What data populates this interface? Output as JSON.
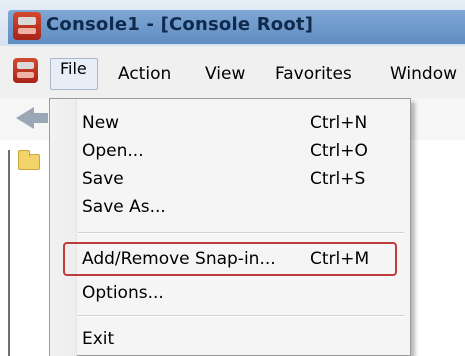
{
  "window": {
    "title": "Console1 - [Console Root]"
  },
  "menubar": {
    "items": [
      "File",
      "Action",
      "View",
      "Favorites",
      "Window"
    ]
  },
  "file_menu": {
    "items": [
      {
        "label": "New",
        "shortcut": "Ctrl+N"
      },
      {
        "label": "Open...",
        "shortcut": "Ctrl+O"
      },
      {
        "label": "Save",
        "shortcut": "Ctrl+S"
      },
      {
        "label": "Save As...",
        "shortcut": ""
      },
      {
        "label": "Add/Remove Snap-in...",
        "shortcut": "Ctrl+M"
      },
      {
        "label": "Options...",
        "shortcut": ""
      },
      {
        "label": "Exit",
        "shortcut": ""
      }
    ]
  },
  "colors": {
    "title_bar": "#6f98ca",
    "title_text": "#0f2a4d",
    "menu_bg": "#f0f0f0",
    "dropdown_bg": "#f5f5f5",
    "highlight_border": "#c03b3b"
  },
  "icons": {
    "app_icon": "console-app-icon",
    "back": "back-arrow-icon",
    "folder": "folder-icon"
  }
}
